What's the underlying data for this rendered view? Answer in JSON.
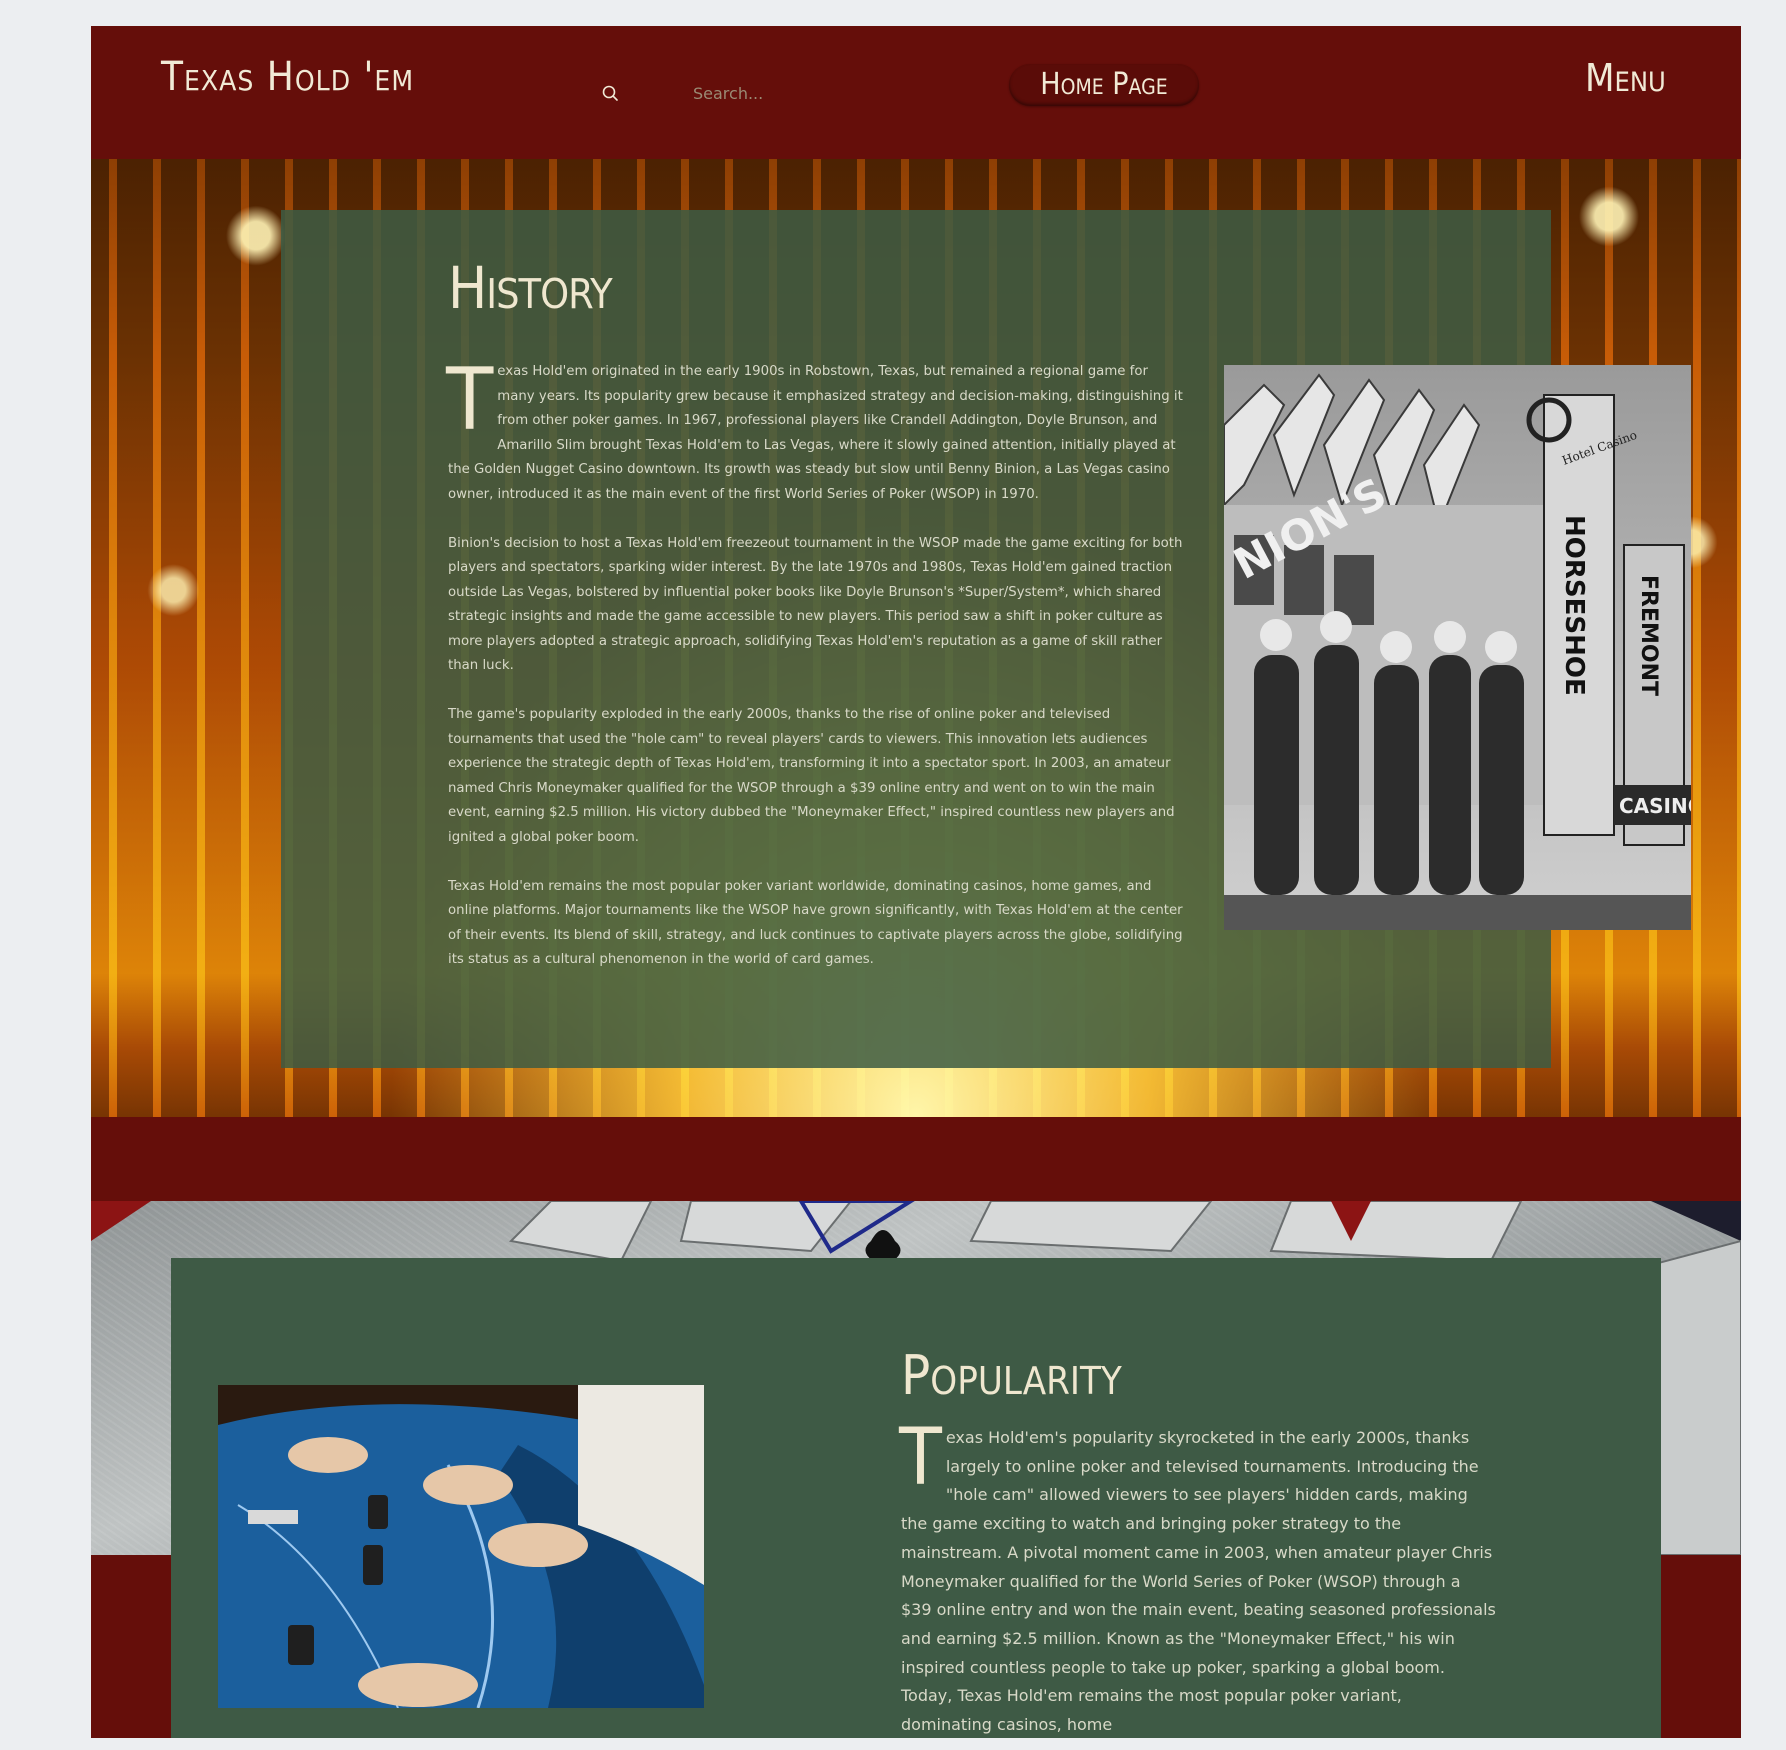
{
  "header": {
    "site_title": "Texas Hold 'em",
    "search_placeholder": "Search...",
    "home_button": "Home Page",
    "menu_button": "Menu"
  },
  "history": {
    "title": "History",
    "dropcap": "T",
    "paragraphs": [
      "exas Hold'em originated in the early 1900s in Robstown, Texas, but remained a regional game for many years. Its popularity grew because it emphasized strategy and decision-making, distinguishing it from other poker games. In 1967, professional players like Crandell Addington, Doyle Brunson, and Amarillo Slim brought Texas Hold'em to Las Vegas, where it slowly gained attention, initially played at the Golden Nugget Casino downtown. Its growth was steady but slow until Benny Binion, a Las Vegas casino owner, introduced it as the main event of the first World Series of Poker (WSOP) in 1970.",
      "Binion's decision to host a Texas Hold'em freezeout tournament in the WSOP made the game exciting for both players and spectators, sparking wider interest. By the late 1970s and 1980s, Texas Hold'em gained traction outside Las Vegas, bolstered by influential poker books like Doyle Brunson's *Super/System*, which shared strategic insights and made the game accessible to new players. This period saw a shift in poker culture as more players adopted a strategic approach, solidifying Texas Hold'em's reputation as a game of skill rather than luck.",
      "The game's popularity exploded in the early 2000s, thanks to the rise of online poker and televised tournaments that used the \"hole cam\" to reveal players' cards to viewers. This innovation lets audiences experience the strategic depth of Texas Hold'em, transforming it into a spectator sport. In 2003, an amateur named Chris Moneymaker qualified for the WSOP through a $39 online entry and went on to win the main event, earning $2.5 million. His victory dubbed the \"Moneymaker Effect,\" inspired countless new players and ignited a global poker boom.",
      "Texas Hold'em remains the most popular poker variant worldwide, dominating casinos, home games, and online platforms. Major tournaments like the WSOP have grown significantly, with Texas Hold'em at the center of their events. Its blend of skill, strategy, and luck continues to captivate players across the globe, solidifying its status as a cultural phenomenon in the world of card games."
    ],
    "photo_signs": [
      "NION'S",
      "HORSESHOE",
      "FREMONT",
      "CASINO",
      "Hotel Casino"
    ]
  },
  "popularity": {
    "title": "Popularity",
    "dropcap": "T",
    "text": "exas Hold'em's popularity skyrocketed in the early 2000s, thanks largely to online poker and televised tournaments. Introducing the \"hole cam\" allowed viewers to see players' hidden cards, making the game exciting to watch and bringing poker strategy to the mainstream. A pivotal moment came in 2003, when amateur player Chris Moneymaker qualified for the World Series of Poker (WSOP) through a $39 online entry and won the main event, beating seasoned professionals and earning $2.5 million. Known as the \"Moneymaker Effect,\" his win inspired countless people to take up poker, sparking a global boom. Today, Texas Hold'em remains the most popular poker variant, dominating casinos, home"
  },
  "colors": {
    "header_bg": "#650e0a",
    "panel_green": "#3e5a45",
    "title_cream": "#efe7cf",
    "body_text": "#d8d9c8"
  },
  "icons": {
    "search": "search-icon"
  }
}
